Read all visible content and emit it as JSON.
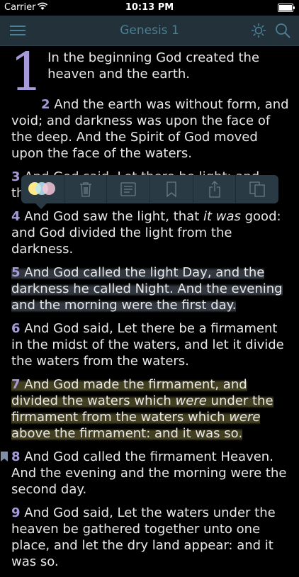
{
  "status_bar": {
    "carrier": "Carrier",
    "time": "10:13 PM"
  },
  "nav": {
    "title": "Genesis 1"
  },
  "popup": {
    "highlight_colors": [
      "#ffe98a",
      "#b9e7f2",
      "#f6c6d6"
    ]
  },
  "verses": [
    {
      "num": "1",
      "text": "In the beginning God created the heaven and the earth."
    },
    {
      "num": "2",
      "text": "And the earth was without form, and void; and darkness was upon the face of the deep. And the Spirit of God moved upon the face of the waters."
    },
    {
      "num": "3",
      "text": "And God said, Let there be light: and there was light."
    },
    {
      "num": "4",
      "text_a": "And God saw the light, that ",
      "italic": "it was",
      "text_b": " good: and God divided the light from the darkness."
    },
    {
      "num": "5",
      "text": "And God called the light Day, and the darkness he called Night. And the evening and the morning were the first day."
    },
    {
      "num": "6",
      "text": "And God said, Let there be a firmament in the midst of the waters, and let it divide the waters from the waters."
    },
    {
      "num": "7",
      "text_a": "And God made the firmament, and divided the waters which ",
      "italic_a": "were",
      "text_b": " under the firmament from the waters which ",
      "italic_b": "were",
      "text_c": " above the firmament: and it was so."
    },
    {
      "num": "8",
      "text": "And God called the firmament Heaven. And the evening and the morning were the second day."
    },
    {
      "num": "9",
      "text": "And God said, Let the waters under the heaven be gathered together unto one place, and let the dry land appear: and it was so."
    }
  ]
}
